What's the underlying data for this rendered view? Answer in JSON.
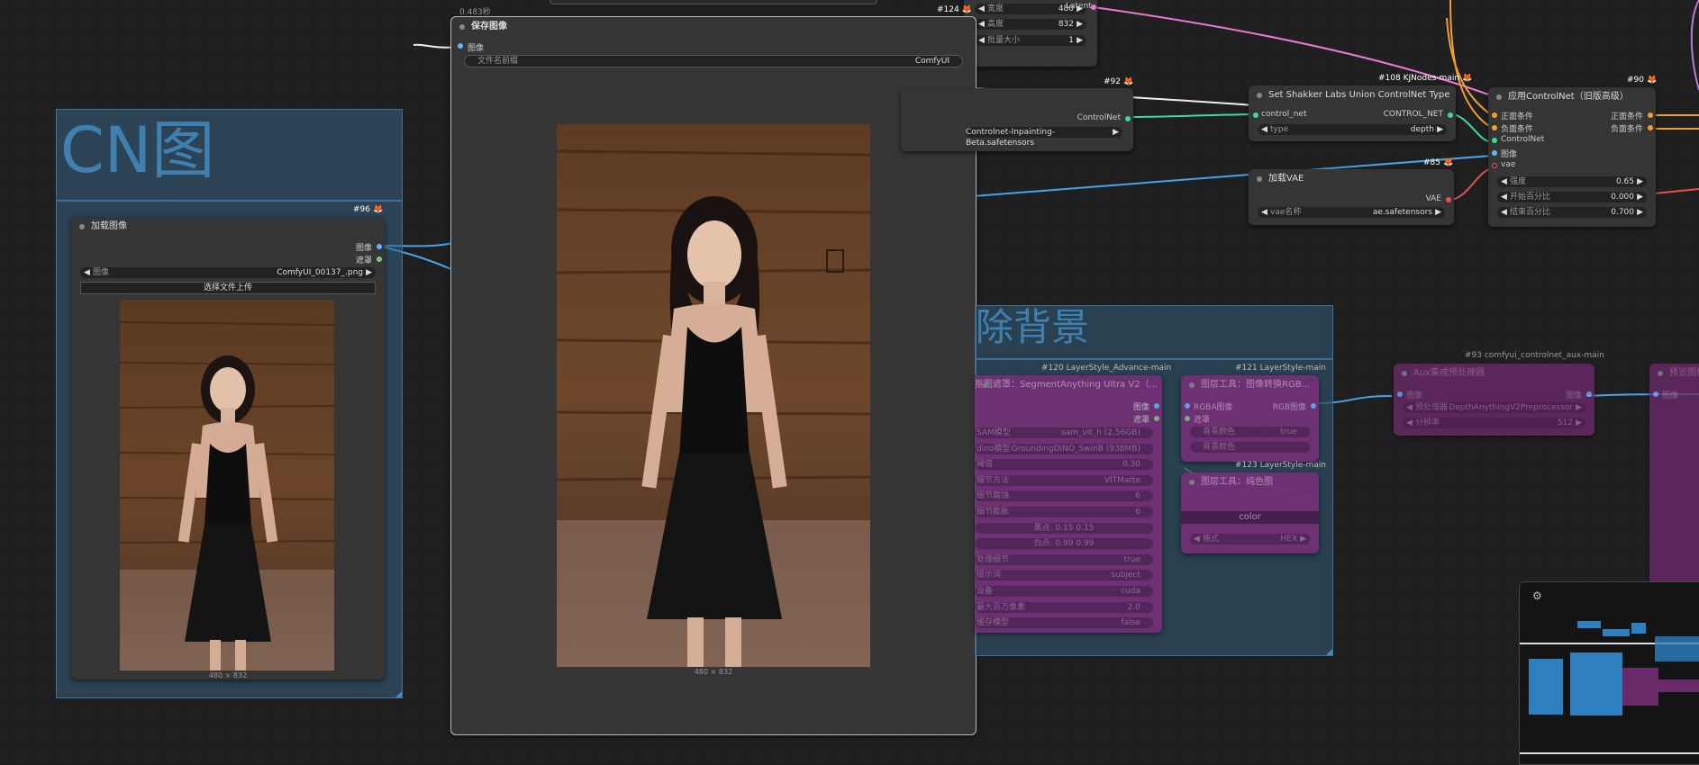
{
  "colors": {
    "canvas": "#1f1f1f",
    "node": "#353535",
    "group_blue": "#2e4e66",
    "group_purple": "#6a2a6a",
    "wire_image": "#4aa3e8",
    "wire_latent": "#e87bd5",
    "wire_control": "#3ddc97",
    "wire_cond": "#f0a030",
    "wire_vae": "#e85050"
  },
  "groups": {
    "cn": {
      "title": "CN图"
    },
    "bg": {
      "title": "除背景"
    }
  },
  "top_timer": "0.483秒",
  "latent_node": {
    "rows": [
      {
        "label": "宽度",
        "value": "480"
      },
      {
        "label": "高度",
        "value": "832"
      },
      {
        "label": "批量大小",
        "value": "1"
      }
    ],
    "output": "Latent"
  },
  "save_node": {
    "badge": "#124",
    "title": "保存图像",
    "input": "图像",
    "prefix_label": "文件名前缀",
    "prefix_value": "ComfyUI",
    "caption": "480 × 832"
  },
  "load_node": {
    "badge": "#96",
    "title": "加载图像",
    "out_image": "图像",
    "out_mask": "遮罩",
    "image_label": "图像",
    "image_value": "ComfyUI_00137_.png",
    "upload_label": "选择文件上传",
    "caption": "480 × 832"
  },
  "controlnet_loader": {
    "badge": "#92",
    "output": "ControlNet",
    "value": "Controlnet-Inpainting-Beta.safetensors"
  },
  "shakker_node": {
    "badge": "#108 KJNodes-main",
    "title": "Set Shakker Labs Union ControlNet Type",
    "in_label": "control_net",
    "out_label": "CONTROL_NET",
    "type_label": "type",
    "type_value": "depth"
  },
  "vae_node": {
    "badge": "#85",
    "title": "加载VAE",
    "output": "VAE",
    "label": "vae名称",
    "value": "ae.safetensors"
  },
  "apply_cn_node": {
    "badge": "#90",
    "title": "应用ControlNet（旧版高级）",
    "inputs": [
      "正面条件",
      "负面条件",
      "ControlNet",
      "图像",
      "vae"
    ],
    "outputs": [
      "正面条件",
      "负面条件"
    ],
    "rows": [
      {
        "label": "强度",
        "value": "0.65"
      },
      {
        "label": "开始百分比",
        "value": "0.000"
      },
      {
        "label": "结束百分比",
        "value": "0.700"
      }
    ]
  },
  "bg_nodes": {
    "n120_badge": "#120 LayerStyle_Advance-main",
    "n120_title": "抠图遮罩：SegmentAnything Ultra V2（...",
    "n120_outputs": [
      "图像",
      "遮罩"
    ],
    "n120_rows": [
      {
        "label": "SAM模型",
        "value": "sam_vit_h (2.56GB)"
      },
      {
        "label": "dino模型",
        "value": "GroundingDINO_SwinB (938MB)"
      },
      {
        "label": "阈值",
        "value": "0.30"
      },
      {
        "label": "细节方法",
        "value": "VITMatte"
      },
      {
        "label": "细节腐蚀",
        "value": "6"
      },
      {
        "label": "细节膨胀",
        "value": "6"
      },
      {
        "label": "",
        "value": "黑点: 0.15 0.15"
      },
      {
        "label": "",
        "value": "白点: 0.99 0.99"
      },
      {
        "label": "处理细节",
        "value": "true"
      },
      {
        "label": "提示词",
        "value": "subject"
      },
      {
        "label": "设备",
        "value": "cuda"
      },
      {
        "label": "最大百万像素",
        "value": "2.0"
      },
      {
        "label": "缓存模型",
        "value": "false"
      }
    ],
    "n121_badge": "#121 LayerStyle-main",
    "n121_title": "图层工具：图像转换RGB...",
    "n121_in": [
      "RGBA图像",
      "遮罩"
    ],
    "n121_out": "RGB图像",
    "n121_row": {
      "label": "背景颜色",
      "value": "true"
    },
    "n121_row2": "背景颜色",
    "n123_badge": "#123 LayerStyle-main",
    "n123_title": "图层工具：纯色图",
    "n123_color": "color",
    "n123_row": {
      "label": "格式",
      "value": "HEX"
    },
    "n93_badge": "#93 comfyui_controlnet_aux-main",
    "n93_title": "Aux集成预处理器",
    "n93_in": "图像",
    "n93_out": "图像",
    "n93_row1": {
      "label": "预处理器",
      "value": "DepthAnythingV2Preprocessor"
    },
    "n93_row2": {
      "label": "分辨率",
      "value": "512"
    },
    "n_right_title": "预览图像",
    "n_right_in": "图像"
  }
}
